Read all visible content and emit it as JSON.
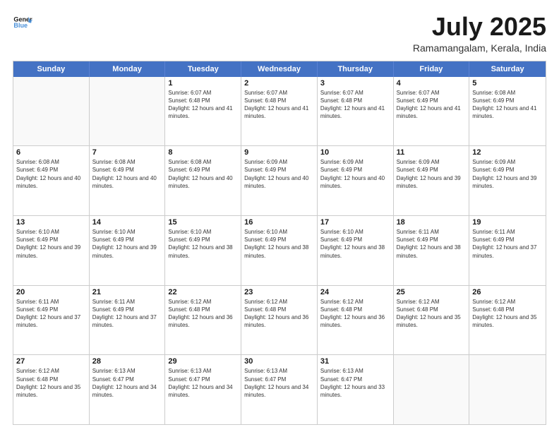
{
  "header": {
    "logo_line1": "General",
    "logo_line2": "Blue",
    "month": "July 2025",
    "location": "Ramamangalam, Kerala, India"
  },
  "days_of_week": [
    "Sunday",
    "Monday",
    "Tuesday",
    "Wednesday",
    "Thursday",
    "Friday",
    "Saturday"
  ],
  "weeks": [
    [
      {
        "num": "",
        "info": ""
      },
      {
        "num": "",
        "info": ""
      },
      {
        "num": "1",
        "info": "Sunrise: 6:07 AM\nSunset: 6:48 PM\nDaylight: 12 hours and 41 minutes."
      },
      {
        "num": "2",
        "info": "Sunrise: 6:07 AM\nSunset: 6:48 PM\nDaylight: 12 hours and 41 minutes."
      },
      {
        "num": "3",
        "info": "Sunrise: 6:07 AM\nSunset: 6:48 PM\nDaylight: 12 hours and 41 minutes."
      },
      {
        "num": "4",
        "info": "Sunrise: 6:07 AM\nSunset: 6:49 PM\nDaylight: 12 hours and 41 minutes."
      },
      {
        "num": "5",
        "info": "Sunrise: 6:08 AM\nSunset: 6:49 PM\nDaylight: 12 hours and 41 minutes."
      }
    ],
    [
      {
        "num": "6",
        "info": "Sunrise: 6:08 AM\nSunset: 6:49 PM\nDaylight: 12 hours and 40 minutes."
      },
      {
        "num": "7",
        "info": "Sunrise: 6:08 AM\nSunset: 6:49 PM\nDaylight: 12 hours and 40 minutes."
      },
      {
        "num": "8",
        "info": "Sunrise: 6:08 AM\nSunset: 6:49 PM\nDaylight: 12 hours and 40 minutes."
      },
      {
        "num": "9",
        "info": "Sunrise: 6:09 AM\nSunset: 6:49 PM\nDaylight: 12 hours and 40 minutes."
      },
      {
        "num": "10",
        "info": "Sunrise: 6:09 AM\nSunset: 6:49 PM\nDaylight: 12 hours and 40 minutes."
      },
      {
        "num": "11",
        "info": "Sunrise: 6:09 AM\nSunset: 6:49 PM\nDaylight: 12 hours and 39 minutes."
      },
      {
        "num": "12",
        "info": "Sunrise: 6:09 AM\nSunset: 6:49 PM\nDaylight: 12 hours and 39 minutes."
      }
    ],
    [
      {
        "num": "13",
        "info": "Sunrise: 6:10 AM\nSunset: 6:49 PM\nDaylight: 12 hours and 39 minutes."
      },
      {
        "num": "14",
        "info": "Sunrise: 6:10 AM\nSunset: 6:49 PM\nDaylight: 12 hours and 39 minutes."
      },
      {
        "num": "15",
        "info": "Sunrise: 6:10 AM\nSunset: 6:49 PM\nDaylight: 12 hours and 38 minutes."
      },
      {
        "num": "16",
        "info": "Sunrise: 6:10 AM\nSunset: 6:49 PM\nDaylight: 12 hours and 38 minutes."
      },
      {
        "num": "17",
        "info": "Sunrise: 6:10 AM\nSunset: 6:49 PM\nDaylight: 12 hours and 38 minutes."
      },
      {
        "num": "18",
        "info": "Sunrise: 6:11 AM\nSunset: 6:49 PM\nDaylight: 12 hours and 38 minutes."
      },
      {
        "num": "19",
        "info": "Sunrise: 6:11 AM\nSunset: 6:49 PM\nDaylight: 12 hours and 37 minutes."
      }
    ],
    [
      {
        "num": "20",
        "info": "Sunrise: 6:11 AM\nSunset: 6:49 PM\nDaylight: 12 hours and 37 minutes."
      },
      {
        "num": "21",
        "info": "Sunrise: 6:11 AM\nSunset: 6:49 PM\nDaylight: 12 hours and 37 minutes."
      },
      {
        "num": "22",
        "info": "Sunrise: 6:12 AM\nSunset: 6:48 PM\nDaylight: 12 hours and 36 minutes."
      },
      {
        "num": "23",
        "info": "Sunrise: 6:12 AM\nSunset: 6:48 PM\nDaylight: 12 hours and 36 minutes."
      },
      {
        "num": "24",
        "info": "Sunrise: 6:12 AM\nSunset: 6:48 PM\nDaylight: 12 hours and 36 minutes."
      },
      {
        "num": "25",
        "info": "Sunrise: 6:12 AM\nSunset: 6:48 PM\nDaylight: 12 hours and 35 minutes."
      },
      {
        "num": "26",
        "info": "Sunrise: 6:12 AM\nSunset: 6:48 PM\nDaylight: 12 hours and 35 minutes."
      }
    ],
    [
      {
        "num": "27",
        "info": "Sunrise: 6:12 AM\nSunset: 6:48 PM\nDaylight: 12 hours and 35 minutes."
      },
      {
        "num": "28",
        "info": "Sunrise: 6:13 AM\nSunset: 6:47 PM\nDaylight: 12 hours and 34 minutes."
      },
      {
        "num": "29",
        "info": "Sunrise: 6:13 AM\nSunset: 6:47 PM\nDaylight: 12 hours and 34 minutes."
      },
      {
        "num": "30",
        "info": "Sunrise: 6:13 AM\nSunset: 6:47 PM\nDaylight: 12 hours and 34 minutes."
      },
      {
        "num": "31",
        "info": "Sunrise: 6:13 AM\nSunset: 6:47 PM\nDaylight: 12 hours and 33 minutes."
      },
      {
        "num": "",
        "info": ""
      },
      {
        "num": "",
        "info": ""
      }
    ]
  ]
}
